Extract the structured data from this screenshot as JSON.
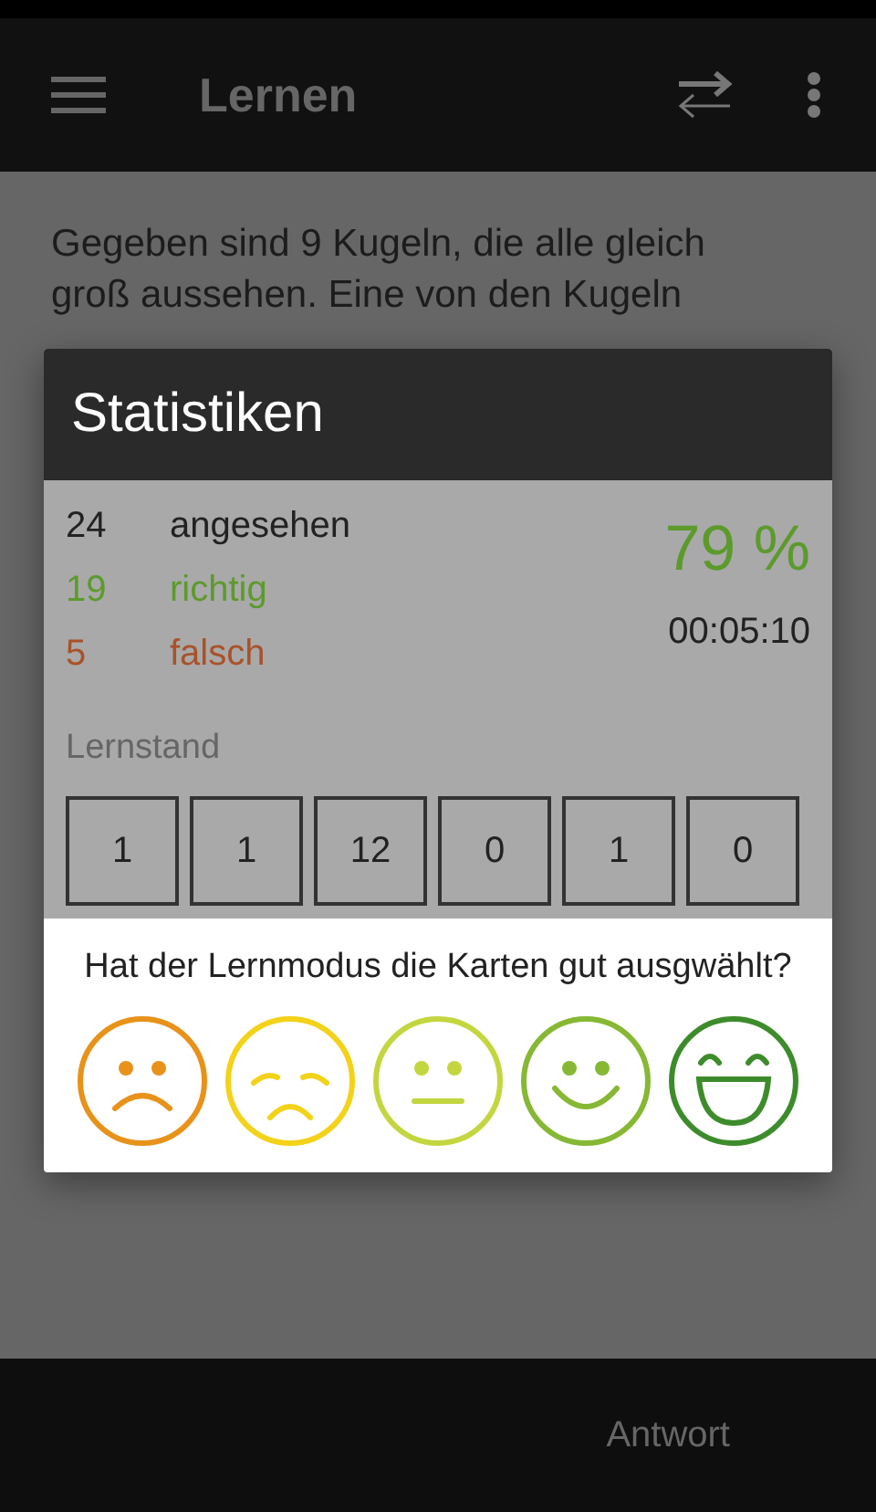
{
  "app_bar": {
    "title": "Lernen"
  },
  "question_lines": [
    "Gegeben sind 9 Kugeln, die alle gleich",
    "groß aussehen. Eine von den Kugeln"
  ],
  "dialog": {
    "title": "Statistiken",
    "counts": [
      {
        "count": "24",
        "label": "angesehen",
        "color": "#222222"
      },
      {
        "count": "19",
        "label": "richtig",
        "color": "#5c9a2c"
      },
      {
        "count": "5",
        "label": "falsch",
        "color": "#a8522a"
      }
    ],
    "percent": "79 %",
    "time": "00:05:10",
    "progress_label": "Lernstand",
    "boxes": [
      "1",
      "1",
      "12",
      "0",
      "1",
      "0"
    ],
    "rating_question": "Hat der Lernmodus die Karten gut ausgwählt?",
    "ratings": [
      {
        "kind": "sad",
        "color": "#e8921a"
      },
      {
        "kind": "unhappy",
        "color": "#f3d219"
      },
      {
        "kind": "neutral",
        "color": "#c4d63f"
      },
      {
        "kind": "happy",
        "color": "#86b834"
      },
      {
        "kind": "laughing",
        "color": "#3d8c2c"
      }
    ]
  },
  "bottom_bar": {
    "button": "Antwort"
  }
}
